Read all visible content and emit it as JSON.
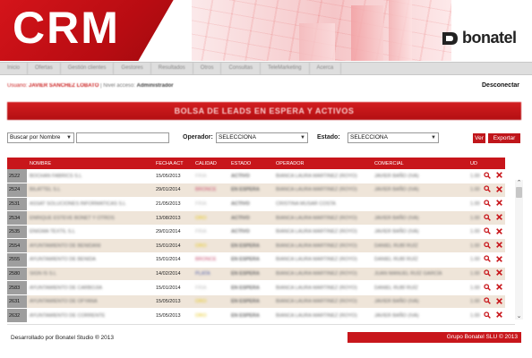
{
  "app": {
    "title": "CRM",
    "brand": "bonatel"
  },
  "colors": {
    "accent": "#c8161b",
    "row_alt": "#efe5d9",
    "id_cell": "#9e9e9e"
  },
  "nav": [
    "Inicio",
    "Ofertas",
    "Gestión clientes",
    "Gestores",
    "Resultados",
    "Otros",
    "Consultas",
    "TeleMarketing",
    "Acerca"
  ],
  "breadcrumb": {
    "label": "Usuario:",
    "user": "JAVIER SANCHEZ LOBATO",
    "sep": "| Nivel acceso:",
    "level": "Administrador"
  },
  "logout": "Desconectar",
  "page_title": "BOLSA DE LEADS EN ESPERA Y ACTIVOS",
  "filters": {
    "search_by": "Buscar por Nombre",
    "search_value": "",
    "operator_label": "Operador:",
    "operator_value": "SELECCIONA",
    "state_label": "Estado:",
    "state_value": "SELECCIONA",
    "view_button": "Ver",
    "export_button": "Exportar"
  },
  "table": {
    "columns": [
      "",
      "NOMBRE",
      "FECHA ACT",
      "CALIDAD",
      "ESTADO",
      "OPERADOR",
      "COMERCIAL",
      "UD"
    ],
    "rows": [
      {
        "id": "2522",
        "name": "BOCHAN FABRICS S.L",
        "date": "15/05/2013",
        "quality": "FRIA",
        "quality_color": "#bbbbbb",
        "state": "ACTIVO",
        "operator": "BIANCA LAURA MARTINEZ (ROYO)",
        "comercial": "JAVIER BAÑO (IVA)",
        "ud": "1.00"
      },
      {
        "id": "2524",
        "name": "BILATTEL S.L",
        "date": "29/01/2014",
        "quality": "BRONCE",
        "quality_color": "#c64a6a",
        "state": "EN ESPERA",
        "operator": "BIANCA LAURA MARTINEZ (ROYO)",
        "comercial": "JAVIER BAÑO (IVA)",
        "ud": "1.00"
      },
      {
        "id": "2531",
        "name": "ASSAT SOLUCIONES INFORMATICAS S.L",
        "date": "21/05/2013",
        "quality": "FRIA",
        "quality_color": "#bbbbbb",
        "state": "ACTIVO",
        "operator": "CRISTINA MUSAR COSTA",
        "comercial": "",
        "ud": "1.00"
      },
      {
        "id": "2534",
        "name": "ENRIQUE ESTEVE BONET Y OTROS",
        "date": "13/08/2013",
        "quality": "ORO",
        "quality_color": "#e6c619",
        "state": "ACTIVO",
        "operator": "BIANCA LAURA MARTINEZ (ROYO)",
        "comercial": "JAVIER BAÑO (IVA)",
        "ud": "1.00"
      },
      {
        "id": "2535",
        "name": "ENIGMA TEXTIL S.L",
        "date": "29/01/2014",
        "quality": "FRIA",
        "quality_color": "#bbbbbb",
        "state": "ACTIVO",
        "operator": "BIANCA LAURA MARTINEZ (ROYO)",
        "comercial": "JAVIER BAÑO (IVA)",
        "ud": "1.00"
      },
      {
        "id": "2554",
        "name": "AYUNTAMIENTO DE BENIDANI",
        "date": "15/01/2014",
        "quality": "ORO",
        "quality_color": "#e6c619",
        "state": "EN ESPERA",
        "operator": "BIANCA LAURA MARTINEZ (ROYO)",
        "comercial": "DANIEL RUBÍ RUÍZ",
        "ud": "1.00"
      },
      {
        "id": "2555",
        "name": "AYUNTAMIENTO DE BENIDA",
        "date": "15/01/2014",
        "quality": "BRONCE",
        "quality_color": "#c64a6a",
        "state": "EN ESPERA",
        "operator": "BIANCA LAURA MARTINEZ (ROYO)",
        "comercial": "DANIEL RUBÍ RUÍZ",
        "ud": "1.00"
      },
      {
        "id": "2580",
        "name": "SIGN IS S.L",
        "date": "14/02/2014",
        "quality": "PLATA",
        "quality_color": "#4a5aa8",
        "state": "EN ESPERA",
        "operator": "BIANCA LAURA MARTINEZ (ROYO)",
        "comercial": "JUAN MANUEL RUÍZ GARCÍA",
        "ud": "1.00"
      },
      {
        "id": "2583",
        "name": "AYUNTAMIENTO DE CARBOJIA",
        "date": "15/01/2014",
        "quality": "FRIA",
        "quality_color": "#bbbbbb",
        "state": "EN ESPERA",
        "operator": "BIANCA LAURA MARTINEZ (ROYO)",
        "comercial": "DANIEL RUBÍ RUÍZ",
        "ud": "1.00"
      },
      {
        "id": "2631",
        "name": "AYUNTAMIENTO DE OFYANA",
        "date": "15/05/2013",
        "quality": "ORO",
        "quality_color": "#e6c619",
        "state": "EN ESPERA",
        "operator": "BIANCA LAURA MARTINEZ (ROYO)",
        "comercial": "JAVIER BAÑO (IVA)",
        "ud": "1.00"
      },
      {
        "id": "2632",
        "name": "AYUNTAMIENTO DE CORRENTE",
        "date": "15/05/2013",
        "quality": "ORO",
        "quality_color": "#e6c619",
        "state": "EN ESPERA",
        "operator": "BIANCA LAURA MARTINEZ (ROYO)",
        "comercial": "JAVIER BAÑO (IVA)",
        "ud": "1.00"
      }
    ]
  },
  "footer": {
    "left": "Desarrollado por Bonatel Studio ® 2013",
    "right": "Grupo Bonatel SLU © 2013"
  }
}
